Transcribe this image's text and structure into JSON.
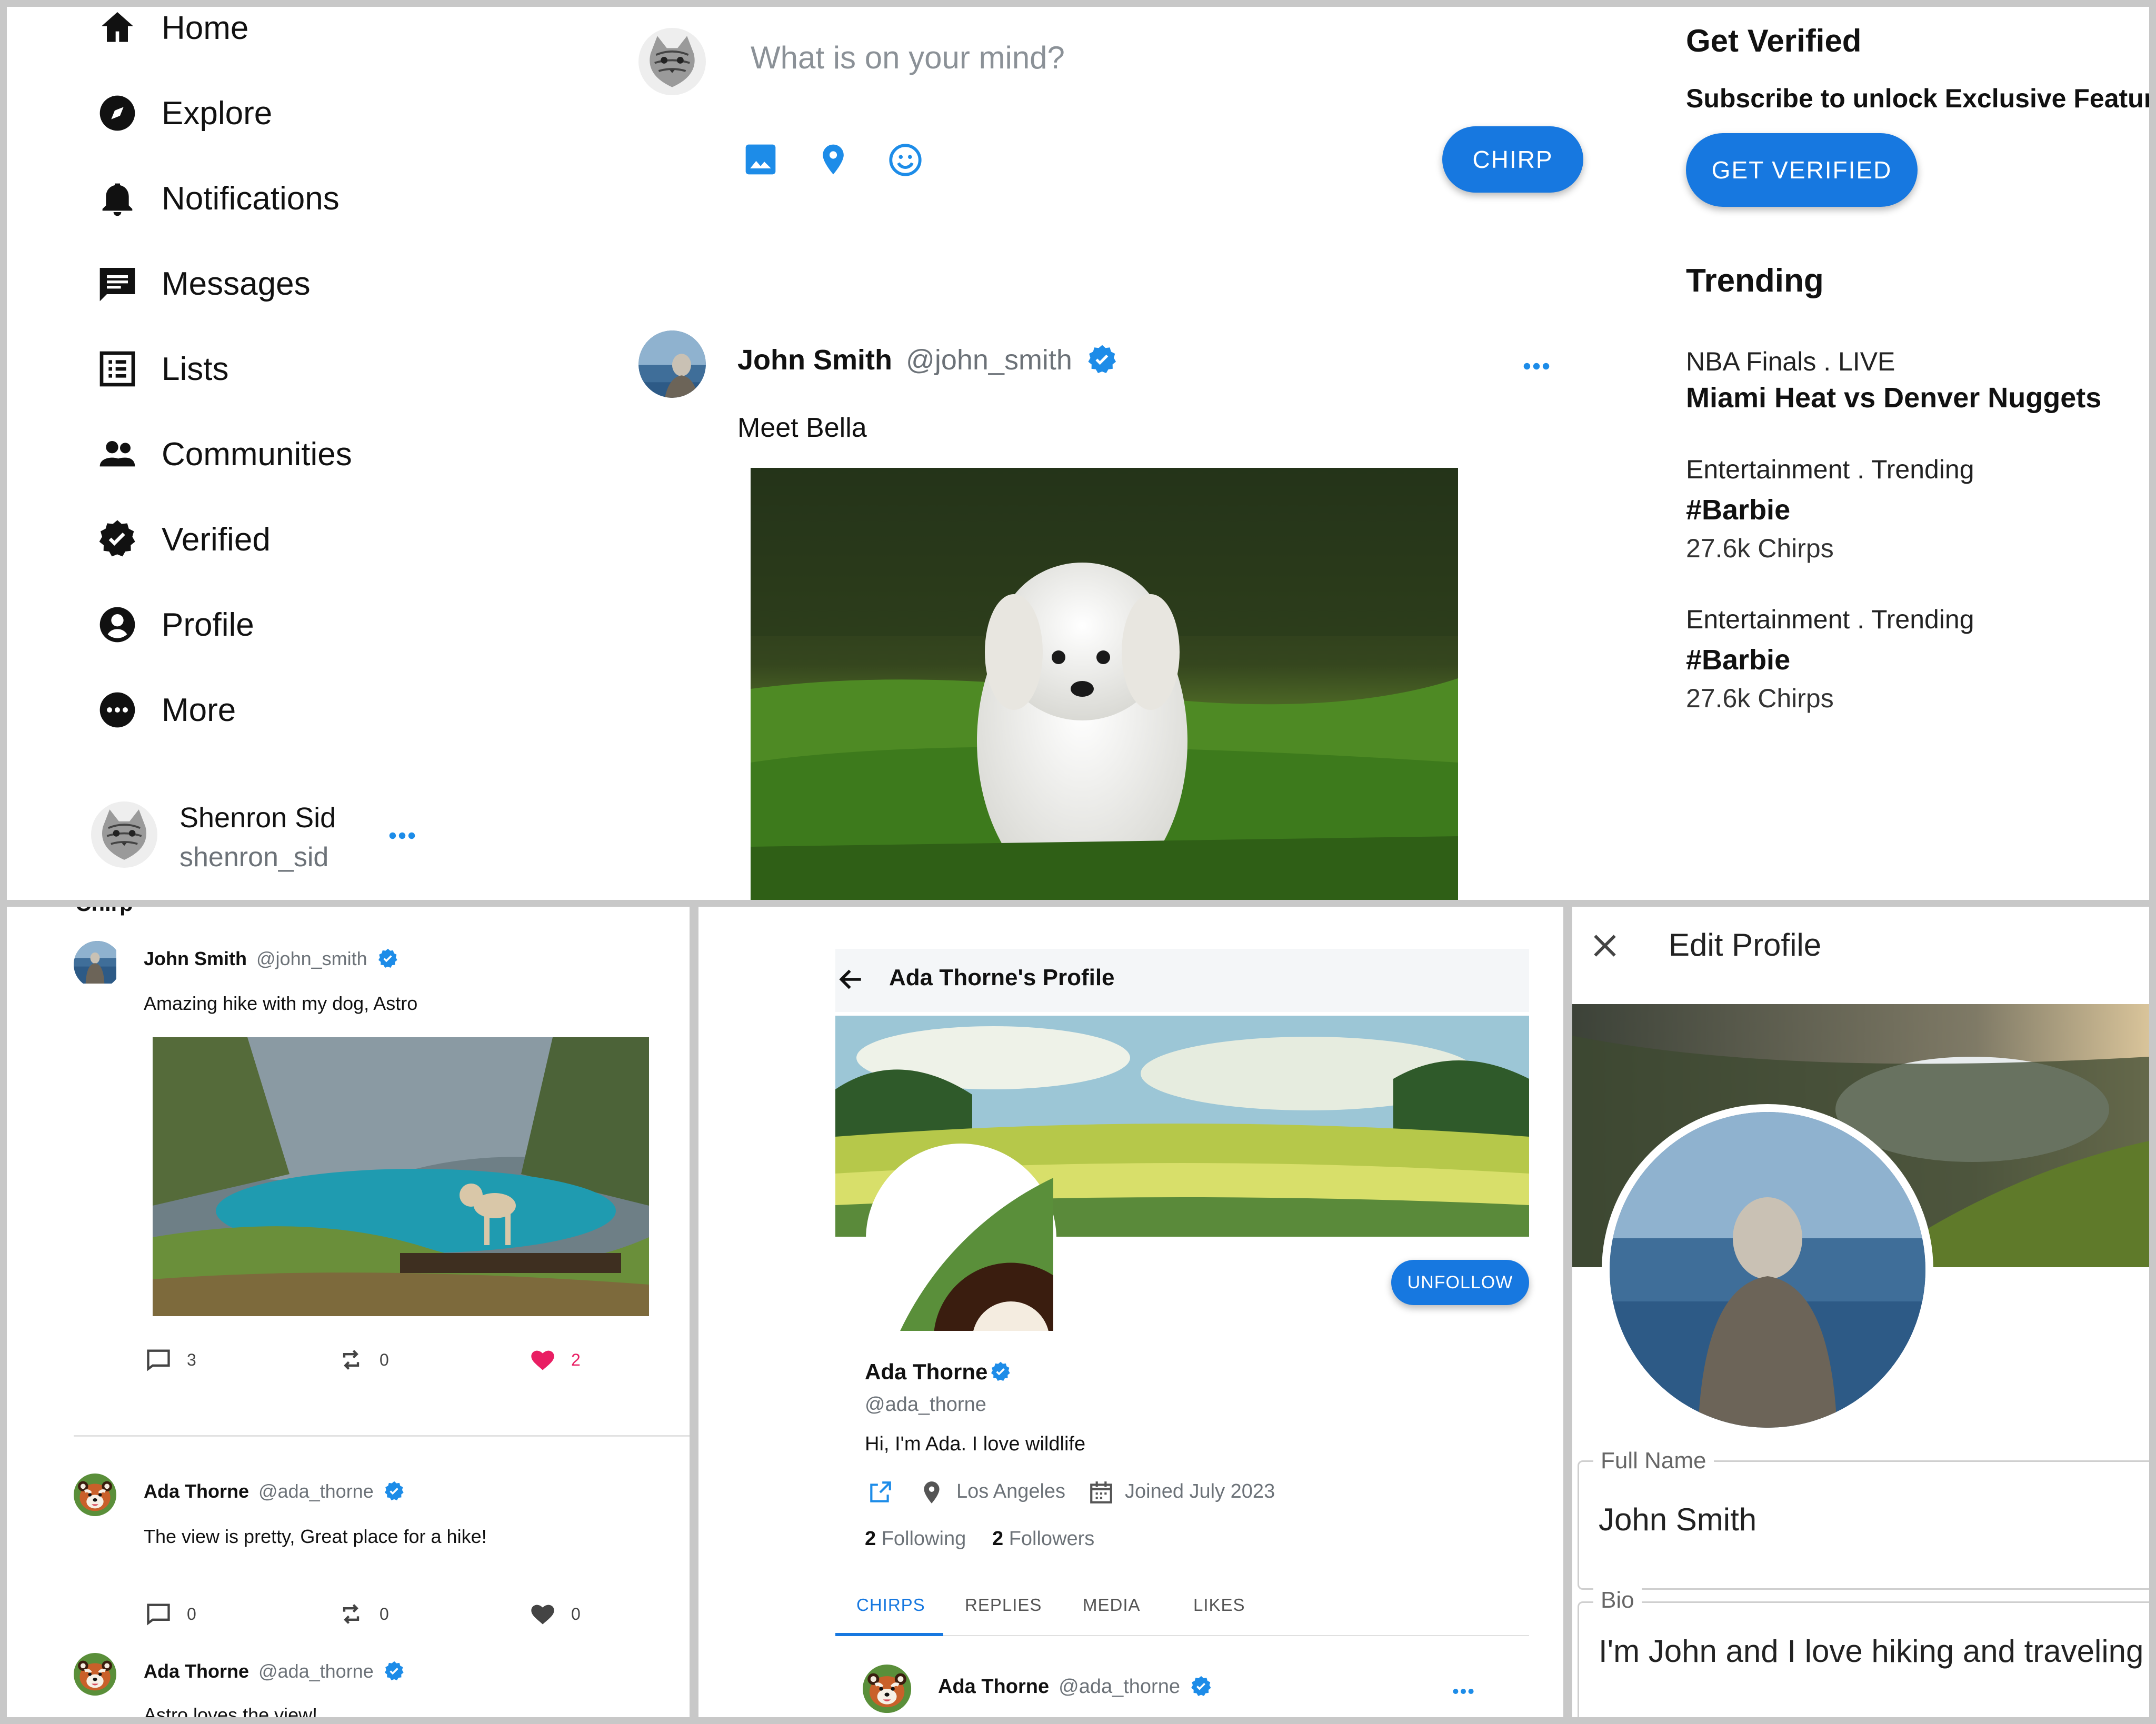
{
  "top": {
    "nav": [
      {
        "key": "home",
        "label": "Home"
      },
      {
        "key": "explore",
        "label": "Explore"
      },
      {
        "key": "notifications",
        "label": "Notifications"
      },
      {
        "key": "messages",
        "label": "Messages"
      },
      {
        "key": "lists",
        "label": "Lists"
      },
      {
        "key": "communities",
        "label": "Communities"
      },
      {
        "key": "verified",
        "label": "Verified"
      },
      {
        "key": "profile",
        "label": "Profile"
      },
      {
        "key": "more",
        "label": "More"
      }
    ],
    "account": {
      "name": "Shenron Sid",
      "handle": "shenron_sid"
    },
    "compose": {
      "placeholder": "What is on your mind?",
      "button": "CHIRP"
    },
    "post": {
      "name": "John Smith",
      "handle": "@john_smith",
      "text": "Meet Bella"
    },
    "aside": {
      "verify_title": "Get Verified",
      "verify_sub": "Subscribe to unlock Exclusive Features",
      "verify_button": "GET VERIFIED",
      "trending_title": "Trending",
      "trends": [
        {
          "meta": "NBA Finals . LIVE",
          "title": "Miami Heat vs Denver Nuggets",
          "count": ""
        },
        {
          "meta": "Entertainment . Trending",
          "title": "#Barbie",
          "count": "27.6k Chirps"
        },
        {
          "meta": "Entertainment . Trending",
          "title": "#Barbie",
          "count": "27.6k Chirps"
        }
      ]
    }
  },
  "chirp_panel": {
    "header": "Chirp",
    "post1": {
      "name": "John Smith",
      "handle": "@john_smith",
      "text": "Amazing hike with my dog, Astro",
      "replies": "3",
      "rechirps": "0",
      "likes": "2"
    },
    "post2": {
      "name": "Ada Thorne",
      "handle": "@ada_thorne",
      "text": "The view is pretty, Great place for a hike!",
      "replies": "0",
      "rechirps": "0",
      "likes": "0"
    },
    "post3": {
      "name": "Ada Thorne",
      "handle": "@ada_thorne",
      "text": "Astro loves the view!"
    }
  },
  "profile_panel": {
    "title": "Ada Thorne's Profile",
    "unfollow": "UNFOLLOW",
    "name": "Ada Thorne",
    "handle": "@ada_thorne",
    "bio": "Hi, I'm Ada. I love wildlife",
    "location": "Los Angeles",
    "joined": "Joined July 2023",
    "following_count": "2",
    "following_label": "Following",
    "followers_count": "2",
    "followers_label": "Followers",
    "tabs": [
      "CHIRPS",
      "REPLIES",
      "MEDIA",
      "LIKES"
    ],
    "post": {
      "name": "Ada Thorne",
      "handle": "@ada_thorne"
    }
  },
  "edit_panel": {
    "title": "Edit Profile",
    "full_name_label": "Full Name",
    "full_name_value": "John Smith",
    "bio_label": "Bio",
    "bio_value": "I'm John and I love hiking and traveling"
  },
  "colors": {
    "accent": "#1778e0",
    "verified": "#1d8ce8",
    "like": "#e91e63"
  }
}
